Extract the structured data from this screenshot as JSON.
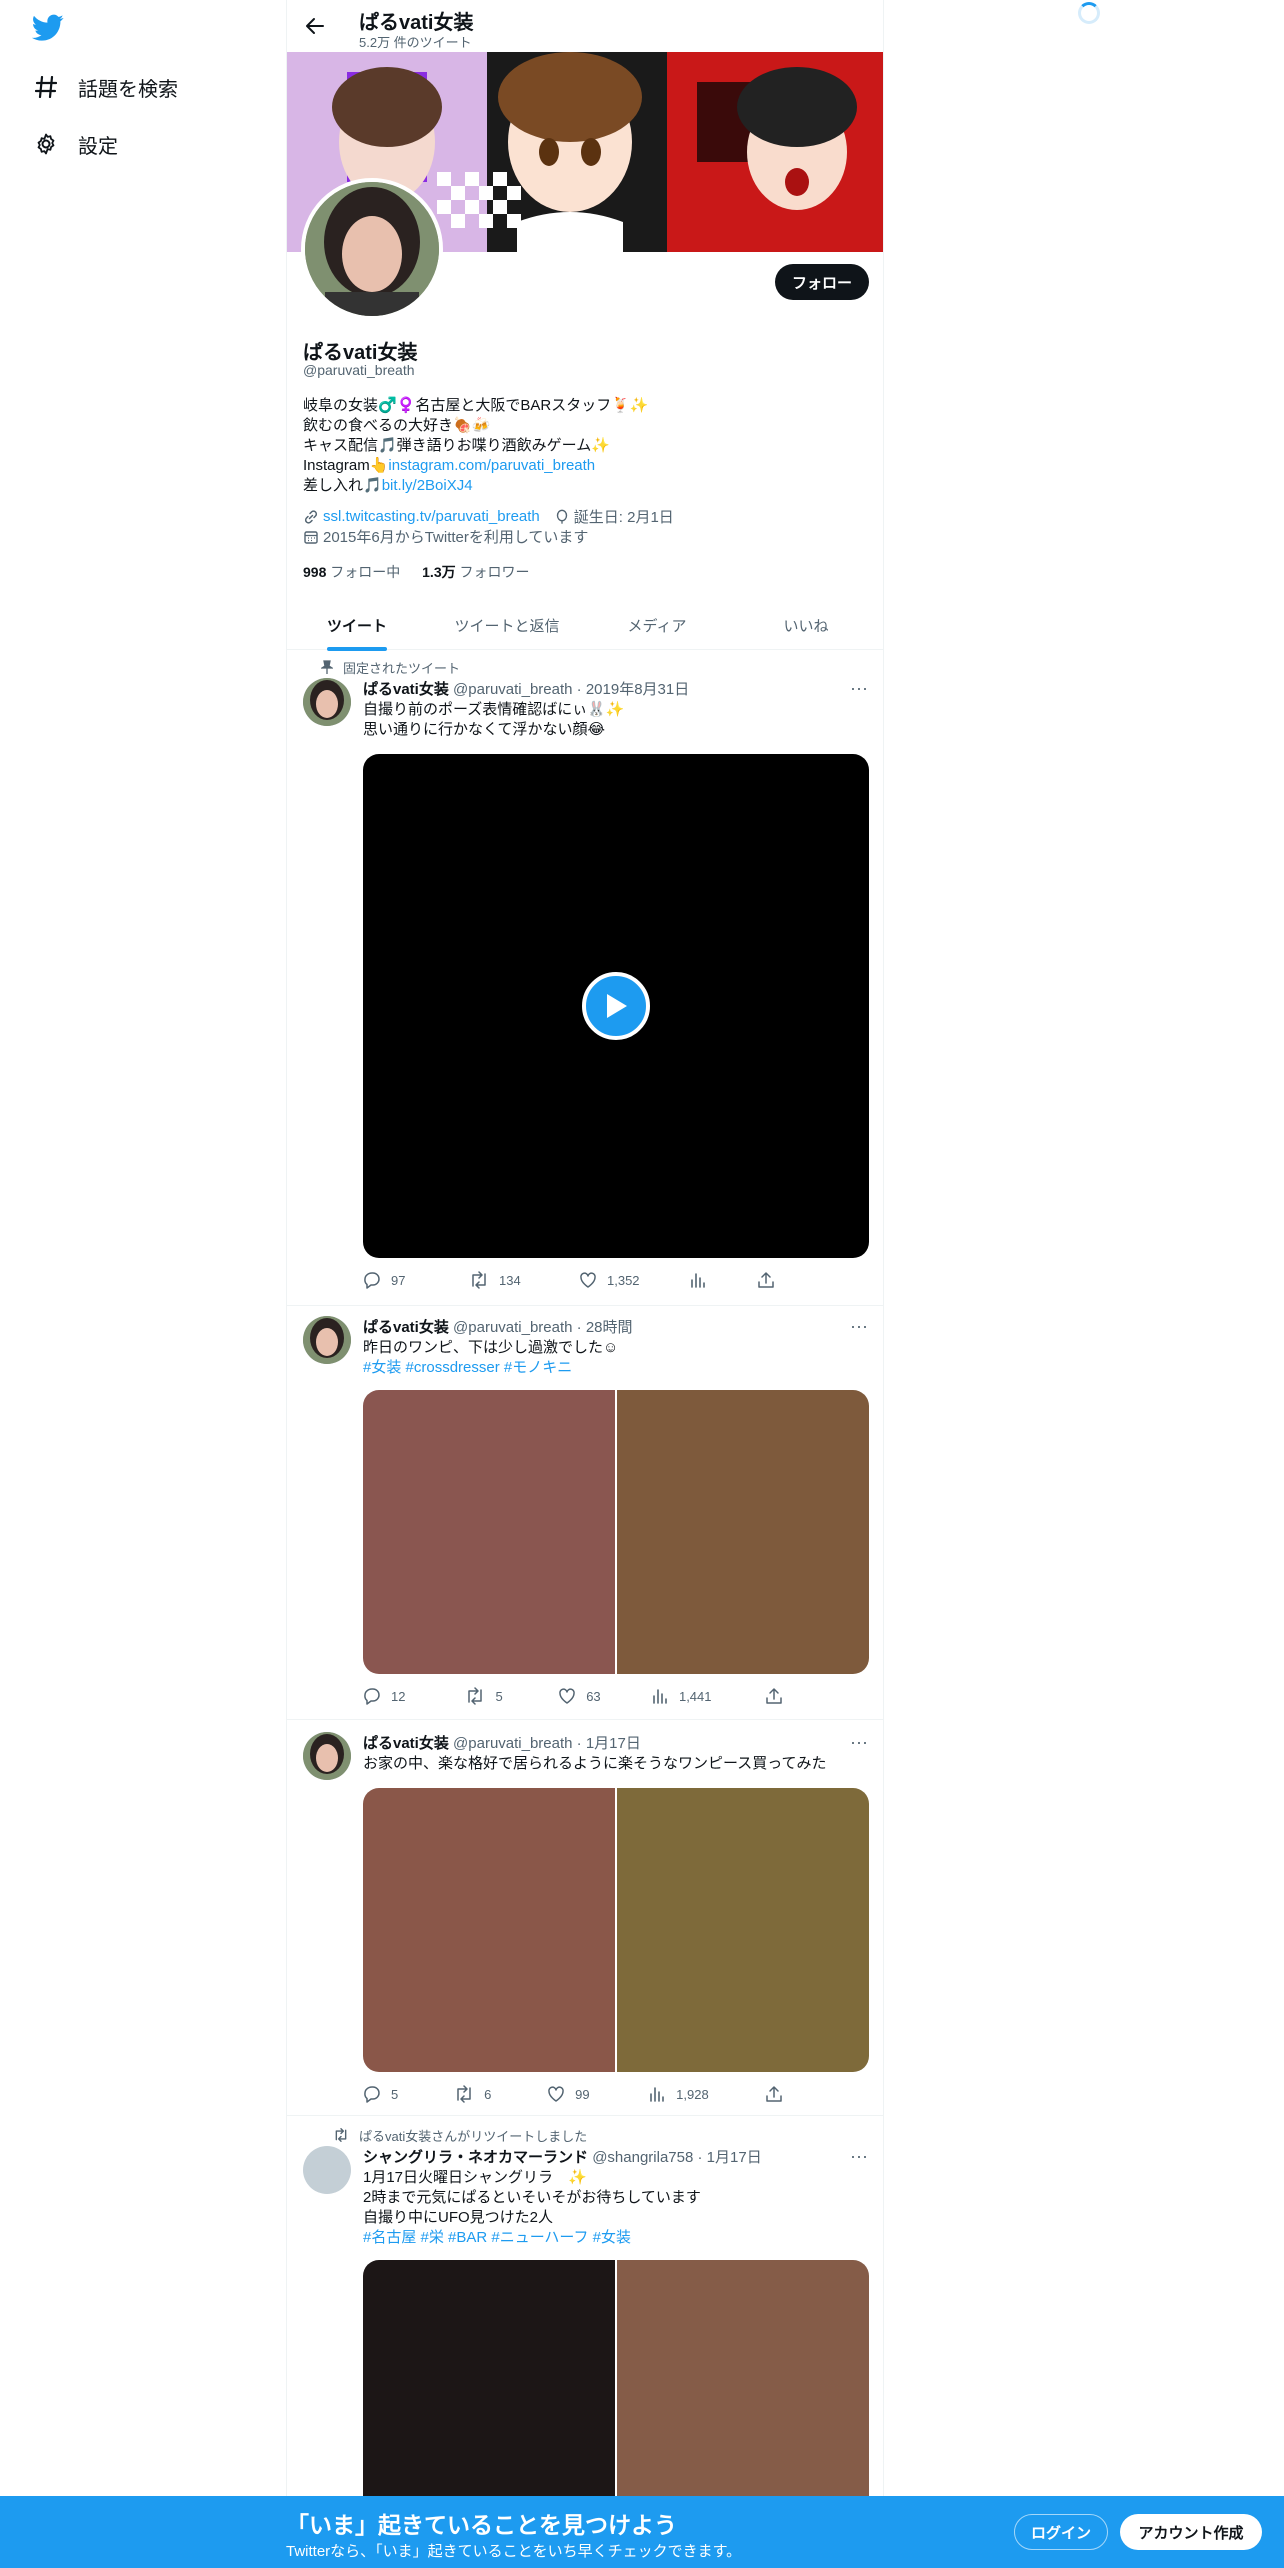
{
  "nav": {
    "explore_label": "話題を検索",
    "settings_label": "設定"
  },
  "header": {
    "name": "ぱるvati女装",
    "tweet_count": "5.2万 件のツイート"
  },
  "profile": {
    "follow_label": "フォロー",
    "name": "ぱるvati女装",
    "handle": "@paruvati_breath",
    "bio": {
      "line1": "岐阜の女装♂️♀️名古屋と大阪でBARスタッフ🍹✨",
      "line2": "飲むの食べるの大好き🍖🍻",
      "line3": "キャス配信🎵弾き語りお喋り酒飲みゲーム✨",
      "line4_prefix": "Instagram👆",
      "line4_link": "instagram.com/paruvati_breath",
      "line5_prefix": "差し入れ🎵",
      "line5_link": "bit.ly/2BoiXJ4"
    },
    "website": "ssl.twitcasting.tv/paruvati_breath",
    "birthday": "誕生日: 2月1日",
    "joined": "2015年6月からTwitterを利用しています",
    "following_count": "998",
    "following_label": "フォロー中",
    "followers_count": "1.3万",
    "followers_label": "フォロワー"
  },
  "tabs": [
    {
      "label": "ツイート"
    },
    {
      "label": "ツイートと返信"
    },
    {
      "label": "メディア"
    },
    {
      "label": "いいね"
    }
  ],
  "tweets": [
    {
      "context": "固定されたツイート",
      "name": "ぱるvati女装",
      "handle": "@paruvati_breath",
      "date": "2019年8月31日",
      "lines": [
        "自撮り前のポーズ表情確認ばにぃ🐰✨",
        "思い通りに行かなくて浮かない顔😂"
      ],
      "replies": "97",
      "retweets": "134",
      "likes": "1,352",
      "views": ""
    },
    {
      "name": "ぱるvati女装",
      "handle": "@paruvati_breath",
      "date": "28時間",
      "lines": [
        "昨日のワンピ、下は少し過激でした☺"
      ],
      "hashtags": "#女装 #crossdresser #モノキニ",
      "replies": "12",
      "retweets": "5",
      "likes": "63",
      "views": "1,441"
    },
    {
      "name": "ぱるvati女装",
      "handle": "@paruvati_breath",
      "date": "1月17日",
      "lines": [
        "お家の中、楽な格好で居られるように楽そうなワンピース買ってみた"
      ],
      "replies": "5",
      "retweets": "6",
      "likes": "99",
      "views": "1,928"
    },
    {
      "context": "ぱるvati女装さんがリツイートしました",
      "name": "シャングリラ・ネオカマーランド",
      "handle": "@shangrila758",
      "date": "1月17日",
      "lines": [
        "1月17日火曜日シャングリラ　✨",
        "2時まで元気にぱるといそいそがお待ちしています",
        "自撮り中にUFO見つけた2人"
      ],
      "hashtags": "#名古屋 #栄 #BAR #ニューハーフ #女装"
    }
  ],
  "bottom": {
    "title": "「いま」起きていることを見つけよう",
    "subtitle": "Twitterなら、「いま」起きていることをいち早くチェックできます。",
    "login": "ログイン",
    "signup": "アカウント作成"
  },
  "colors": {
    "accent": "#1d9bf0",
    "text": "#0f1419",
    "muted": "#536471"
  }
}
